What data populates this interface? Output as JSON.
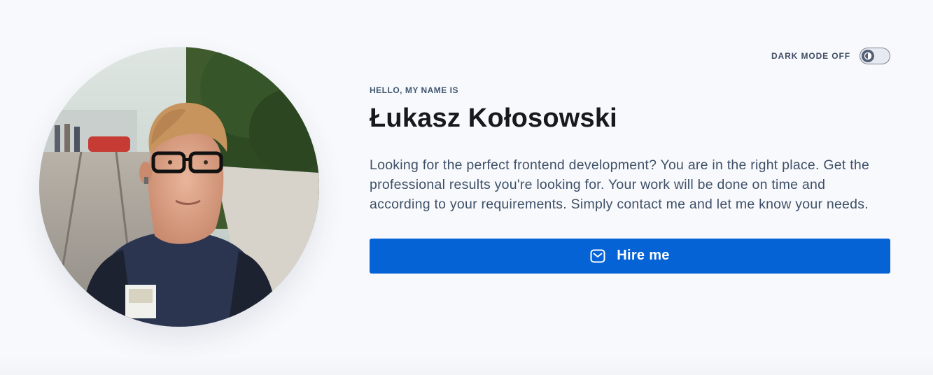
{
  "theme_toggle": {
    "label": "DARK MODE OFF",
    "icon": "contrast-icon",
    "state": "off"
  },
  "profile": {
    "avatar_alt": "Photo of Łukasz Kołosowski",
    "eyebrow": "HELLO, MY NAME IS",
    "name": "Łukasz Kołosowski",
    "bio": "Looking for the perfect frontend development? You are in the right place. Get the professional results you're looking for. Your work will be done on time and according to your requirements. Simply contact me and let me know your needs."
  },
  "cta": {
    "label": "Hire me",
    "icon": "mail-icon"
  },
  "colors": {
    "accent": "#0563d5",
    "heading": "#17191e",
    "body_text": "#3e5067",
    "background": "#f8f9fc"
  }
}
